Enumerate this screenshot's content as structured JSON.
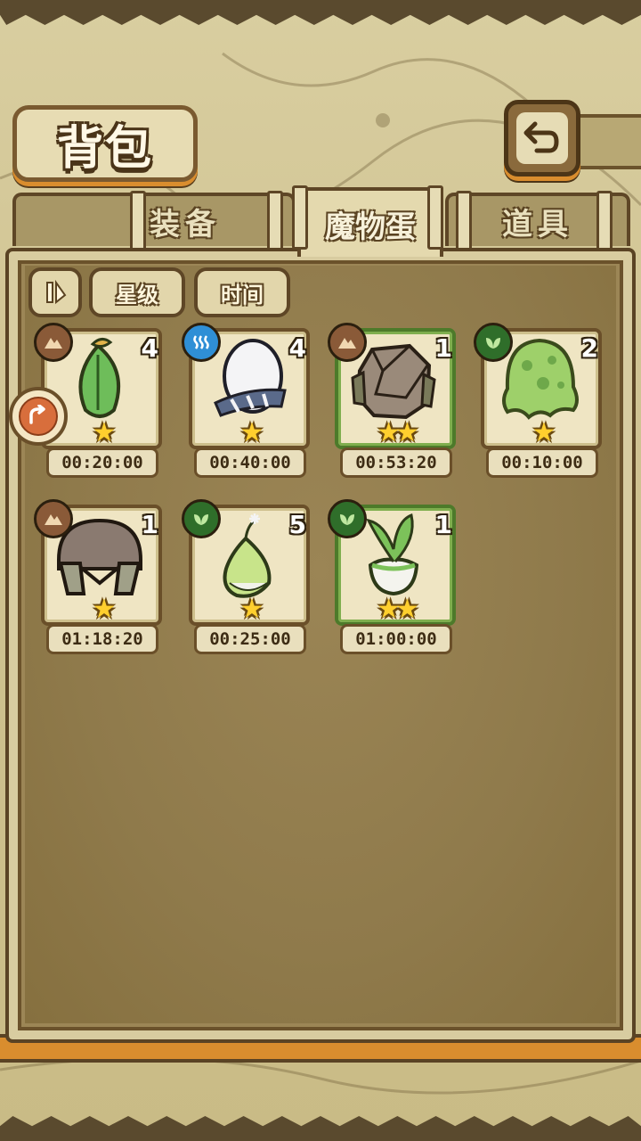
{
  "header": {
    "title": "背包"
  },
  "tabs": [
    {
      "label": "装备",
      "active": false
    },
    {
      "label": "魔物蛋",
      "active": true
    },
    {
      "label": "道具",
      "active": false
    }
  ],
  "filters": {
    "sort_icon": "sort-toggle-icon",
    "star_label": "星级",
    "time_label": "时间"
  },
  "items": [
    {
      "element": "earth-icon",
      "count": "4",
      "stars": "★",
      "time": "00:20:00",
      "art": "leaf-sprout-egg",
      "rare": false
    },
    {
      "element": "water-icon",
      "count": "4",
      "stars": "★",
      "time": "00:40:00",
      "art": "white-egg",
      "rare": false
    },
    {
      "element": "earth-icon",
      "count": "1",
      "stars": "★★",
      "time": "00:53:20",
      "art": "rock-golem-egg",
      "rare": true
    },
    {
      "element": "plant-icon",
      "count": "2",
      "stars": "★",
      "time": "00:10:00",
      "art": "slime-egg",
      "rare": false
    },
    {
      "element": "earth-icon",
      "count": "1",
      "stars": "★",
      "time": "01:18:20",
      "art": "helmet-egg",
      "rare": false
    },
    {
      "element": "plant-icon",
      "count": "5",
      "stars": "★",
      "time": "00:25:00",
      "art": "bulb-egg",
      "rare": false
    },
    {
      "element": "plant-icon",
      "count": "1",
      "stars": "★★",
      "time": "01:00:00",
      "art": "turnip-egg",
      "rare": true
    }
  ],
  "colors": {
    "panel": "#9c8656",
    "accent_orange": "#d98d2e",
    "rare_border": "#4d7a2a"
  }
}
